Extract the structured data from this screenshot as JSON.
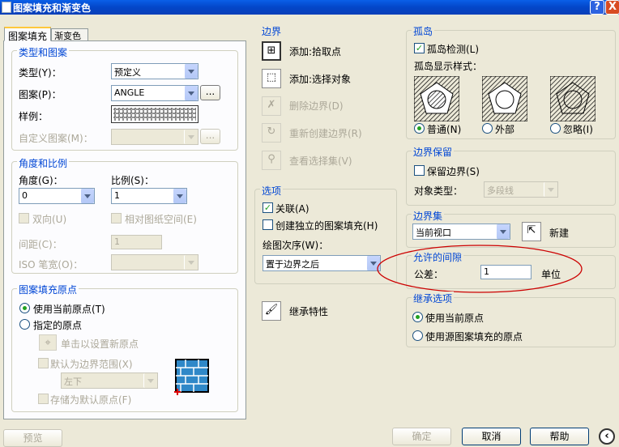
{
  "title": "图案填充和渐变色",
  "tb": {
    "help": "?",
    "close": "X"
  },
  "tabs": [
    "图案填充",
    "渐变色"
  ],
  "typePattern": {
    "title": "类型和图案",
    "type_label": "类型(Y)：",
    "type_value": "预定义",
    "pattern_label": "图案(P)：",
    "pattern_value": "ANGLE",
    "browse": "...",
    "swatch_label": "样例：",
    "custom_label": "自定义图案(M)：",
    "custom_browse": "..."
  },
  "angleScale": {
    "title": "角度和比例",
    "angle_label": "角度(G)：",
    "angle_value": "0",
    "scale_label": "比例(S)：",
    "scale_value": "1",
    "double": "双向(U)",
    "relative": "相对图纸空间(E)",
    "spacing_label": "间距(C)：",
    "spacing_value": "1",
    "iso_label": "ISO 笔宽(O)："
  },
  "origin": {
    "title": "图案填充原点",
    "current": "使用当前原点(T)",
    "specified": "指定的原点",
    "click_set": "单击以设置新原点",
    "default_extent": "默认为边界范围(X)",
    "position": "左下",
    "store": "存储为默认原点(F)"
  },
  "boundary": {
    "title": "边界",
    "add_pick": "添加:拾取点",
    "add_select": "添加:选择对象",
    "remove": "删除边界(D)",
    "recreate": "重新创建边界(R)",
    "view": "查看选择集(V)"
  },
  "options": {
    "title": "选项",
    "associative": "关联(A)",
    "independent": "创建独立的图案填充(H)",
    "draw_order_label": "绘图次序(W)：",
    "draw_order_value": "置于边界之后"
  },
  "inherit": "继承特性",
  "islands": {
    "title": "孤岛",
    "detect": "孤岛检测(L)",
    "style_label": "孤岛显示样式：",
    "normal": "普通(N)",
    "outer": "外部",
    "ignore": "忽略(I)"
  },
  "retain": {
    "title": "边界保留",
    "retain": "保留边界(S)",
    "type_label": "对象类型：",
    "type_value": "多段线"
  },
  "bset": {
    "title": "边界集",
    "value": "当前视口",
    "new": "新建"
  },
  "gap": {
    "title": "允许的间隙",
    "tol_label": "公差：",
    "tol_value": "1",
    "unit": "单位"
  },
  "inheritOpt": {
    "title": "继承选项",
    "current": "使用当前原点",
    "source": "使用源图案填充的原点"
  },
  "footer": {
    "preview": "预览",
    "ok": "确定",
    "cancel": "取消",
    "help": "帮助"
  },
  "colors": {
    "title_bar": "#0a5fe8",
    "group_title": "#0046d5",
    "annotation": "#cc0000",
    "check": "#21a121"
  }
}
